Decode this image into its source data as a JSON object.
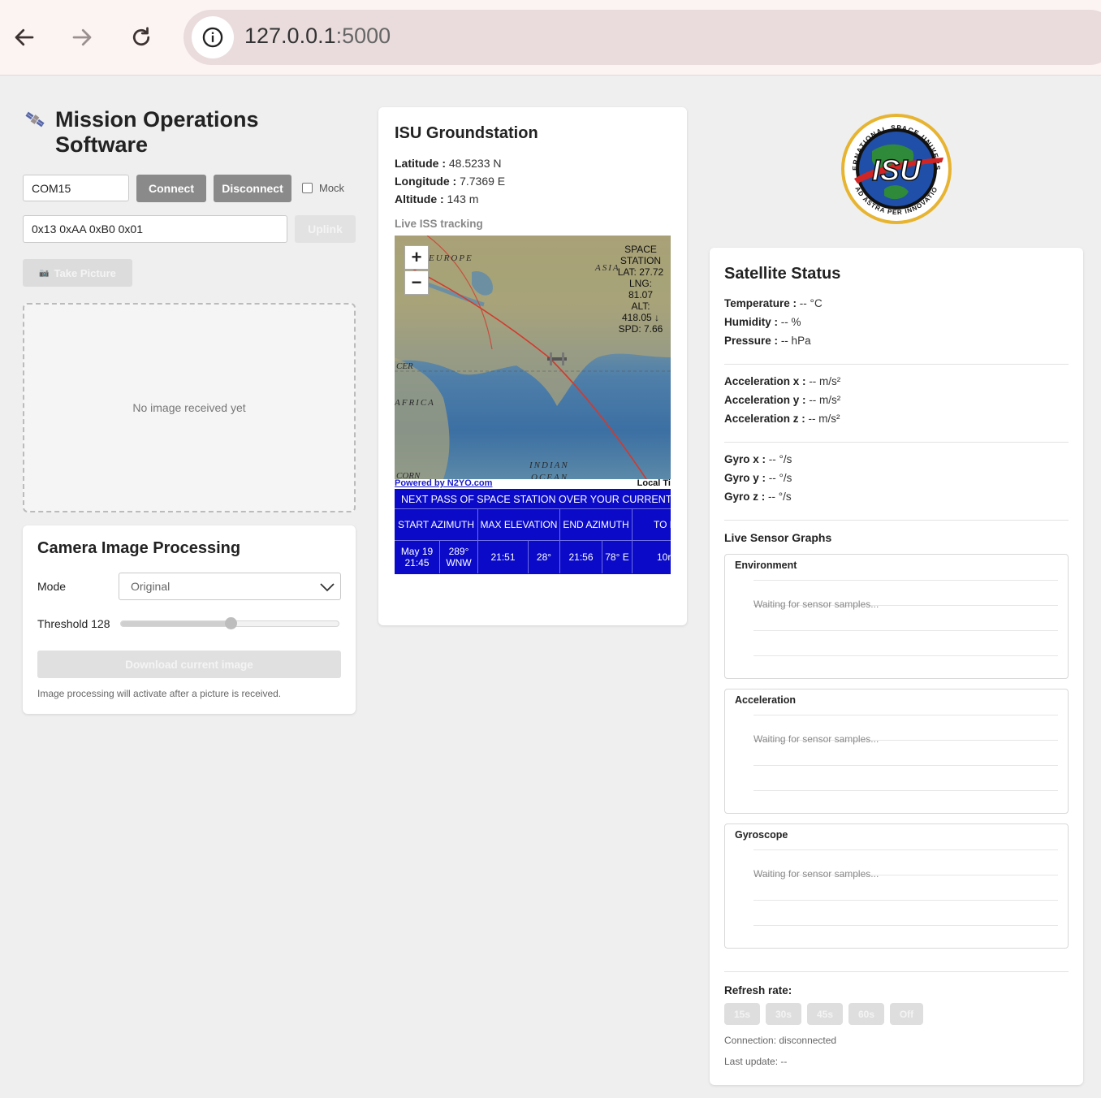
{
  "browser": {
    "url_host": "127.0.0.1",
    "url_port": ":5000"
  },
  "app": {
    "title": "Mission Operations Software"
  },
  "controls": {
    "port_value": "COM15",
    "connect_label": "Connect",
    "disconnect_label": "Disconnect",
    "mock_label": "Mock",
    "command_value": "0x13 0xAA 0xB0 0x01",
    "uplink_label": "Uplink",
    "take_picture_label": "Take Picture",
    "camera_icon": "📷"
  },
  "image_panel": {
    "placeholder": "No image received yet"
  },
  "processing": {
    "title": "Camera Image Processing",
    "mode_label": "Mode",
    "mode_value": "Original",
    "threshold_label": "Threshold 128",
    "threshold_value": 128,
    "threshold_max": 255,
    "download_label": "Download current image",
    "note": "Image processing will activate after a picture is received."
  },
  "groundstation": {
    "title": "ISU Groundstation",
    "latitude_label": "Latitude :",
    "latitude_value": "48.5233 N",
    "longitude_label": "Longitude :",
    "longitude_value": "7.7369 E",
    "altitude_label": "Altitude :",
    "altitude_value": "143 m",
    "tracking_label": "Live ISS tracking",
    "map": {
      "zoom_in": "+",
      "zoom_out": "−",
      "iss_lines": [
        "SPACE",
        "STATION",
        "LAT: 27.72",
        "LNG:",
        "81.07",
        "ALT:",
        "418.05 ↓",
        "SPD: 7.66"
      ],
      "labels": [
        "EUROPE",
        "ASIA",
        "CER",
        "AFRICA",
        "INDIAN",
        "OCEAN",
        "CORN"
      ],
      "powered_by": "Powered by N2YO.com",
      "local_time": "Local Ti"
    },
    "pass": {
      "title": "NEXT PASS OF SPACE STATION OVER YOUR CURRENT L",
      "headers": [
        "START AZIMUTH",
        "MAX ELEVATION",
        "END AZIMUTH",
        "TO DUR"
      ],
      "row": [
        "May 19 21:45",
        "289° WNW",
        "21:51",
        "28°",
        "21:56",
        "78° E",
        "10r"
      ]
    }
  },
  "satellite": {
    "logo_top": "INTERNATIONAL SPACE UNIVERSITY",
    "logo_bottom": "AD ASTRA PER INNOVATIO",
    "logo_text": "ISU",
    "title": "Satellite Status",
    "env": [
      {
        "label": "Temperature :",
        "value": "-- °C"
      },
      {
        "label": "Humidity :",
        "value": "-- %"
      },
      {
        "label": "Pressure :",
        "value": "-- hPa"
      }
    ],
    "accel": [
      {
        "label": "Acceleration x :",
        "value": "-- m/s²"
      },
      {
        "label": "Acceleration y :",
        "value": "-- m/s²"
      },
      {
        "label": "Acceleration z :",
        "value": "-- m/s²"
      }
    ],
    "gyro": [
      {
        "label": "Gyro x :",
        "value": "-- °/s"
      },
      {
        "label": "Gyro y :",
        "value": "-- °/s"
      },
      {
        "label": "Gyro z :",
        "value": "-- °/s"
      }
    ],
    "graphs_title": "Live Sensor Graphs",
    "graphs": [
      {
        "title": "Environment",
        "waiting": "Waiting for sensor samples..."
      },
      {
        "title": "Acceleration",
        "waiting": "Waiting for sensor samples..."
      },
      {
        "title": "Gyroscope",
        "waiting": "Waiting for sensor samples..."
      }
    ],
    "refresh_label": "Refresh rate:",
    "refresh_options": [
      "15s",
      "30s",
      "45s",
      "60s",
      "Off"
    ],
    "connection": "Connection: disconnected",
    "last_update": "Last update: --"
  },
  "colors": {
    "pass_bg": "#0a0ac8",
    "orbit": "#d23a2e",
    "button_dark": "#8a8a8a"
  }
}
